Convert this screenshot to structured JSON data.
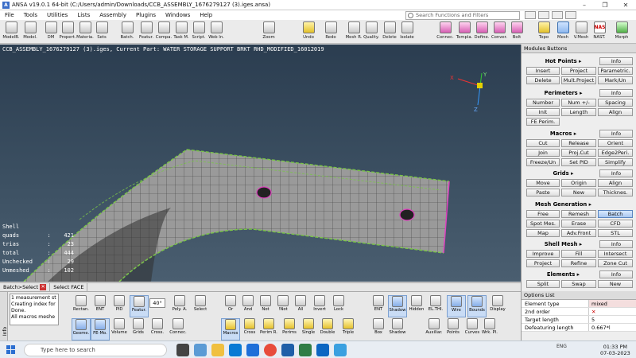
{
  "title": "ANSA v19.0.1 64-bit (C:/Users/admin/Downloads/CCB_ASSEMBLY_1676279127 (3).iges.ansa)",
  "window_controls": [
    "–",
    "❐",
    "✕"
  ],
  "menu": [
    "File",
    "Tools",
    "Utilities",
    "Lists",
    "Assembly",
    "Plugins",
    "Windows",
    "Help"
  ],
  "search_placeholder": "Search Functions and Filters",
  "toolbar": {
    "left": [
      "ModelB.",
      "Model.",
      "DM",
      "Propert.",
      "Materia.",
      "Sets"
    ],
    "mid": [
      "Batch.",
      "Featur.",
      "Compa.",
      "Task M.",
      "Script.",
      "Web In."
    ],
    "zoom": "Zoom",
    "edit": [
      "Undo",
      "Redo",
      "Mesh R.",
      "Quality.",
      "Delete",
      "Isolate"
    ],
    "conn": [
      "Connec.",
      "Templa.",
      "Define.",
      "Conver.",
      "Bolt"
    ],
    "right": [
      "Topo",
      "Mesh",
      "V.Mesh",
      "NAST.",
      "Morph"
    ],
    "nast_badge": "NAS"
  },
  "viewport": {
    "header": "CCB_ASSEMBLY_1676279127 (3).iges,  Current Part: WATER STORAGE SUPPORT BRKT RHD_MODIFIED_16012019",
    "axis_x": "X",
    "axis_y": "Y",
    "axis_z": "Z",
    "stats_title": "Shell",
    "stats": [
      {
        "k": "quads",
        "v": "421"
      },
      {
        "k": "trias",
        "v": "23"
      },
      {
        "k": "total",
        "v": "444"
      },
      {
        "k": "Unchecked",
        "v": "29"
      },
      {
        "k": "Unmeshed",
        "v": "102"
      }
    ]
  },
  "panel": {
    "title": "Modules Buttons",
    "groups": [
      {
        "name": "Hot Points",
        "info": "Info",
        "buttons": [
          "Insert",
          "Project",
          "Parametric.",
          "Delete",
          "Mult.Project",
          "Mark/Un"
        ]
      },
      {
        "name": "Perimeters",
        "info": "Info",
        "buttons": [
          "Number",
          "Num +/-",
          "Spacing",
          "Init",
          "Length",
          "Align",
          "FE Perim."
        ]
      },
      {
        "name": "Macros",
        "info": "Info",
        "buttons": [
          "Cut",
          "Release",
          "Orient",
          "Join",
          "Proj.Cut",
          "Edge2Peri.",
          "Freeze/Un",
          "Set PID",
          "Simplify"
        ]
      },
      {
        "name": "Grids",
        "info": "Info",
        "buttons": [
          "Move",
          "Origin",
          "Align",
          "Paste",
          "New",
          "Thicknes."
        ]
      },
      {
        "name": "Mesh Generation",
        "info": "",
        "buttons": [
          "Free",
          "Remesh",
          "Batch",
          "Spot Mes.",
          "Erase",
          "CFD",
          "Map",
          "Adv.Front",
          "STL"
        ]
      },
      {
        "name": "Shell Mesh",
        "info": "Info",
        "buttons": [
          "Improve",
          "Fill",
          "Intersect",
          "Project",
          "Refine",
          "Zone Cut"
        ]
      },
      {
        "name": "Elements",
        "info": "Info",
        "buttons": [
          "Split",
          "Swap",
          "New"
        ]
      }
    ]
  },
  "statusbar": [
    "Batch>Select",
    "Select FACE"
  ],
  "messages": [
    "1 measurement st",
    "Creating index for",
    "Done.",
    "All macros meshe"
  ],
  "info_tab": "Info",
  "bottom_tools": {
    "row1": [
      "Rectan.",
      "ENT",
      "PID",
      "Featur.",
      "40°",
      "Poly. A.",
      "Select",
      "Or",
      "And",
      "Not",
      "!Not",
      "All",
      "Invert",
      "Lock",
      "ENT",
      "Shadow",
      "Hidden",
      "EL.THI.",
      "Wire",
      "Bounds",
      "Display"
    ],
    "row2": [
      "Geome.",
      "FE-Mo.",
      "Volume",
      "Grids",
      "Cross.",
      "Connec.",
      "Macros",
      "Cross",
      "Perim R.",
      "Perims",
      "Single",
      "Double",
      "Triple",
      "Box",
      "Shadow",
      "Auxiliar.",
      "Points",
      "Curves",
      "Wrk. Pl."
    ]
  },
  "options_list": {
    "title": "Options List",
    "rows": [
      {
        "k": "Element type",
        "v": "mixed"
      },
      {
        "k": "2nd order",
        "v": "✕"
      },
      {
        "k": "Target length",
        "v": "5"
      },
      {
        "k": "Defeaturing length",
        "v": "0.667*l"
      }
    ]
  },
  "taskbar": {
    "search": "Type here to search",
    "time": "01:33 PM",
    "date": "07-03-2023",
    "tray": "ENG"
  },
  "colors": {
    "accent": "#3a6fb0",
    "viewport_top": "#2b3d50",
    "mesh_fill": "#9a9a9a",
    "edge_green": "#7bc44a",
    "edge_magenta": "#e040c0"
  }
}
